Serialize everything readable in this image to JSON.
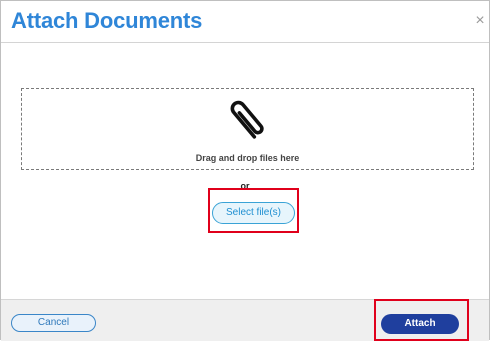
{
  "dialog": {
    "title": "Attach Documents",
    "close_symbol": "×"
  },
  "dropzone": {
    "icon": "paperclip-icon",
    "text": "Drag and drop files here"
  },
  "separator_text": "or",
  "select_button_label": "Select file(s)",
  "footer": {
    "cancel_label": "Cancel",
    "attach_label": "Attach"
  },
  "colors": {
    "title": "#2f86d8",
    "highlight": "#e0001b",
    "attach_button": "#1f3f9e"
  }
}
